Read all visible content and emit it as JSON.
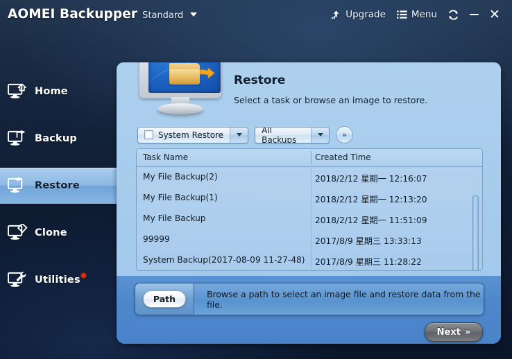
{
  "titlebar": {
    "brand_name": "AOMEI Backupper",
    "edition": "Standard",
    "upgrade_label": "Upgrade",
    "menu_label": "Menu",
    "upgrade_icon": "upload-arrow-icon",
    "menu_icon": "list-lines-icon",
    "refresh_icon": "refresh-circular-arrows-icon",
    "minimize_icon": "minimize-icon",
    "close_label": "✕"
  },
  "sidebar": {
    "items": [
      {
        "label": "Home",
        "icon": "monitor-home-icon",
        "active": false,
        "badge": false
      },
      {
        "label": "Backup",
        "icon": "monitor-backup-icon",
        "active": false,
        "badge": false
      },
      {
        "label": "Restore",
        "icon": "monitor-restore-icon",
        "active": true,
        "badge": false
      },
      {
        "label": "Clone",
        "icon": "monitor-clone-icon",
        "active": false,
        "badge": false
      },
      {
        "label": "Utilities",
        "icon": "monitor-wrench-icon",
        "active": false,
        "badge": true
      }
    ]
  },
  "hero": {
    "title": "Restore",
    "subtitle": "Select a task or browse an image to restore.",
    "icon": "monitor-folder-restore-icon"
  },
  "toolbar": {
    "system_restore_label": "System Restore",
    "system_restore_checked": false,
    "backups_filter_label": "All Backups",
    "expand_label": "»"
  },
  "table": {
    "columns": [
      "Task Name",
      "Created Time"
    ],
    "rows": [
      {
        "task_name": "My File Backup(2)",
        "created_time": "2018/2/12 星期一 12:16:07"
      },
      {
        "task_name": "My File Backup(1)",
        "created_time": "2018/2/12 星期一 12:13:20"
      },
      {
        "task_name": "My File Backup",
        "created_time": "2018/2/12 星期一 11:51:09"
      },
      {
        "task_name": "99999",
        "created_time": "2017/8/9 星期三 13:33:13"
      },
      {
        "task_name": "System Backup(2017-08-09 11-27-48)",
        "created_time": "2017/8/9 星期三 11:28:22"
      }
    ]
  },
  "pathbar": {
    "button_label": "Path",
    "description": "Browse a path to select an image file and restore data from the file."
  },
  "footer": {
    "next_label": "Next",
    "next_chevrons": "»"
  },
  "colors": {
    "window_bg": "#14243c",
    "panel_bg": "#a6cbec",
    "panel_lower_bg": "#4e87cb",
    "active_nav": "#8db9e4",
    "badge_red": "#e8280c",
    "next_button": "#6f7277"
  }
}
